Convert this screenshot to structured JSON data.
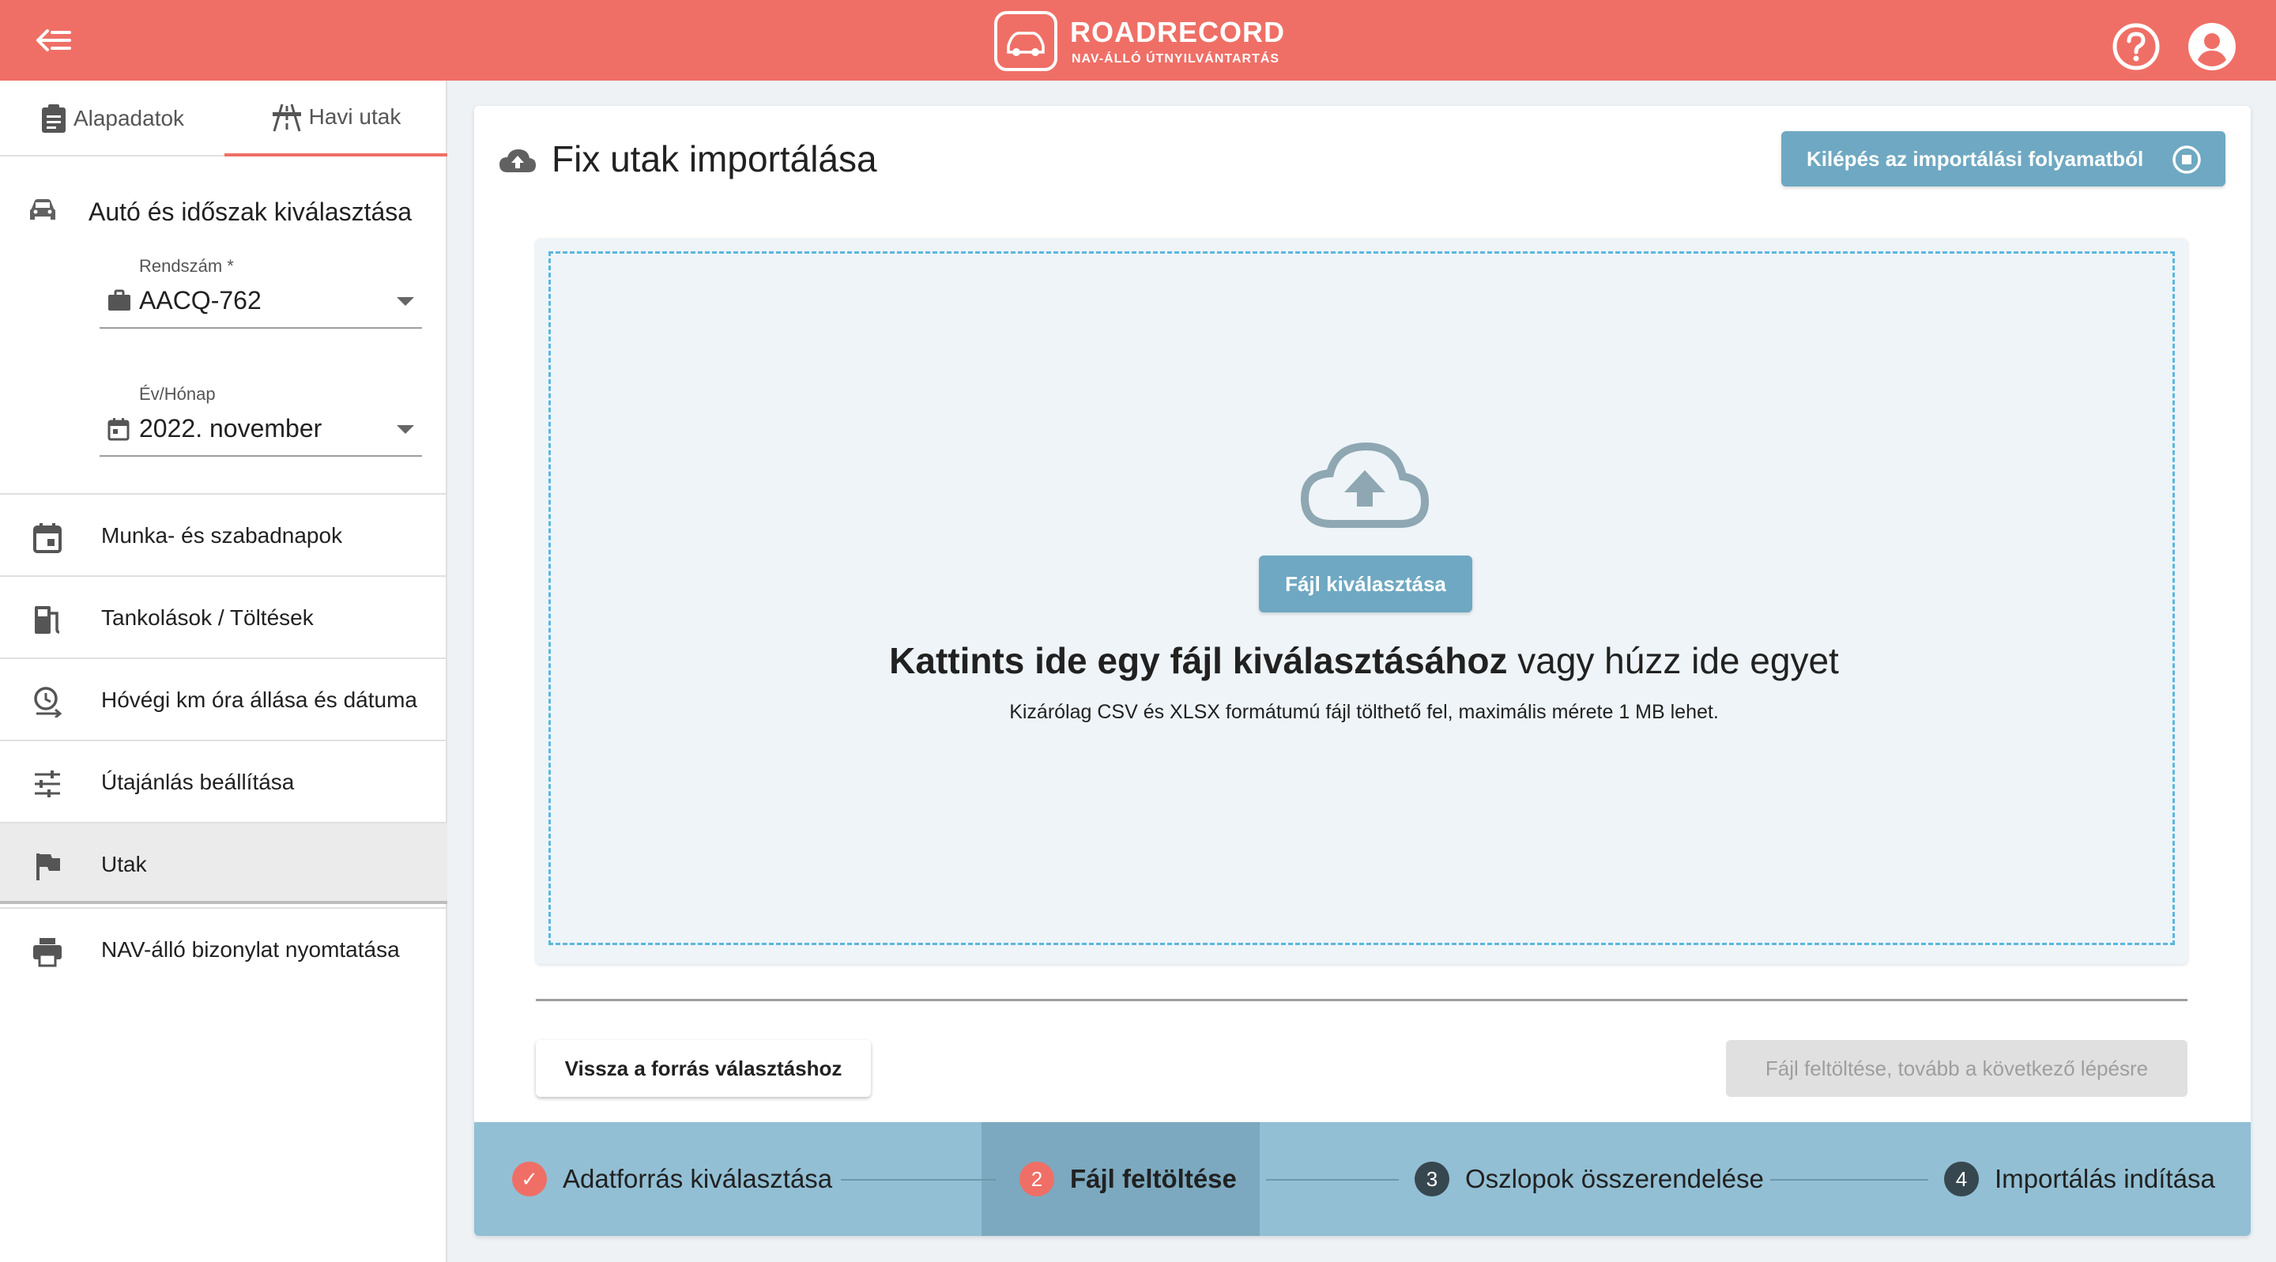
{
  "header": {
    "brand_title": "ROADRECORD",
    "brand_subtitle": "NAV-ÁLLÓ ÚTNYILVÁNTARTÁS",
    "icons": [
      "arrow-back-icon",
      "help-icon",
      "account-icon"
    ],
    "colors": {
      "header_bg": "#ef6f66",
      "accent": "#6fa8c2"
    }
  },
  "sidebar": {
    "tabs": [
      {
        "label": "Alapadatok",
        "icon": "clipboard-icon"
      },
      {
        "label": "Havi utak",
        "icon": "road-icon",
        "active": true
      }
    ],
    "section_title": "Autó és időszak kiválasztása",
    "plate_field": {
      "label": "Rendszám *",
      "value": "AACQ-762"
    },
    "period_field": {
      "label": "Év/Hónap",
      "value": "2022. november"
    },
    "items": [
      {
        "label": "Munka- és szabadnapok",
        "icon": "calendar-icon"
      },
      {
        "label": "Tankolások / Töltések",
        "icon": "fuel-icon"
      },
      {
        "label": "Hóvégi km óra állása és dátuma",
        "icon": "clock-icon"
      },
      {
        "label": "Útajánlás beállítása",
        "icon": "tune-icon"
      },
      {
        "label": "Utak",
        "icon": "flag-icon",
        "active": true
      },
      {
        "label": "NAV-álló bizonylat nyomtatása",
        "icon": "print-icon"
      }
    ]
  },
  "main": {
    "title": "Fix utak importálása",
    "exit_button": "Kilépés az importálási folyamatból",
    "dropzone": {
      "button": "Fájl kiválasztása",
      "main_bold": "Kattints ide egy fájl kiválasztásához",
      "main_rest": " vagy húzz ide egyet",
      "sub": "Kizárólag CSV és XLSX formátumú fájl tölthető fel, maximális mérete 1 MB lehet."
    },
    "back_button": "Vissza a forrás választáshoz",
    "next_button": "Fájl feltöltése, tovább a következő lépésre"
  },
  "stepper": {
    "steps": [
      {
        "num": "✓",
        "label": "Adatforrás kiválasztása",
        "state": "done"
      },
      {
        "num": "2",
        "label": "Fájl feltöltése",
        "state": "active"
      },
      {
        "num": "3",
        "label": "Oszlopok összerendelése",
        "state": "pending"
      },
      {
        "num": "4",
        "label": "Importálás indítása",
        "state": "pending"
      }
    ]
  }
}
